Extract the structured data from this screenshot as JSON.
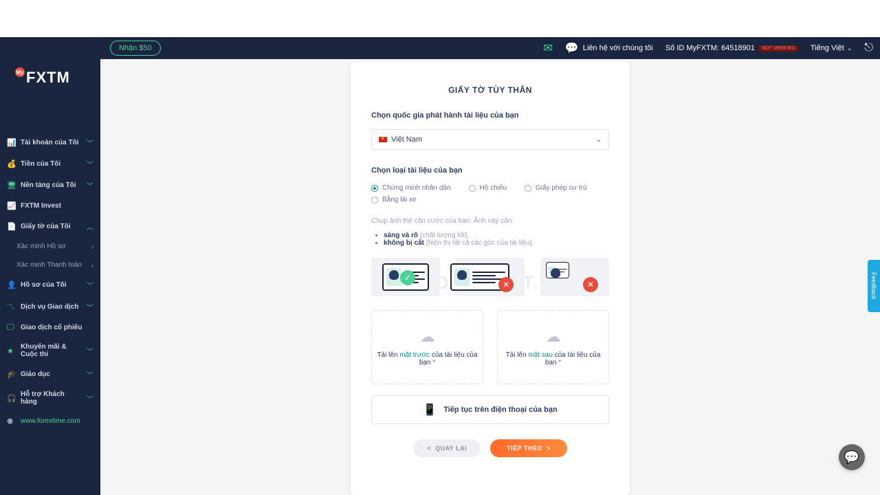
{
  "header": {
    "bonus_label": "Nhận $50",
    "contact_label": "Liên hệ với chúng tôi",
    "account_id_label": "Số ID MyFXTM: 64518901",
    "not_verified_badge": "NOT VERIFIED",
    "language": "Tiếng Việt"
  },
  "logo": {
    "my": "My",
    "brand": "FXTM"
  },
  "sidebar": {
    "items": [
      {
        "icon": "📊",
        "label": "Tài khoản của Tôi",
        "expand": "﹀"
      },
      {
        "icon": "💰",
        "label": "Tiền của Tôi",
        "expand": "﹀"
      },
      {
        "icon": "🖥",
        "label": "Nền tảng của Tôi",
        "expand": "﹀"
      },
      {
        "icon": "📈",
        "label": "FXTM Invest"
      },
      {
        "icon": "📄",
        "label": "Giấy tờ của Tôi",
        "expand": "︿"
      },
      {
        "sub": true,
        "label": "Xác minh Hồ sơ",
        "arrow": "›"
      },
      {
        "sub": true,
        "label": "Xác minh Thanh toán",
        "arrow": "›"
      },
      {
        "icon": "👤",
        "label": "Hồ sơ của Tôi",
        "expand": "﹀"
      },
      {
        "icon": "〽",
        "label": "Dịch vụ Giao dịch",
        "expand": "﹀"
      },
      {
        "icon": "🖵",
        "label": "Giao dịch cổ phiếu"
      },
      {
        "icon": "★",
        "label": "Khuyến mãi & Cuộc thi",
        "expand": "﹀"
      },
      {
        "icon": "🎓",
        "label": "Giáo dục",
        "expand": "﹀"
      },
      {
        "icon": "🎧",
        "label": "Hỗ trợ Khách hàng",
        "expand": "﹀"
      },
      {
        "icon": "⊗",
        "label": "www.forextime.com",
        "link": true
      }
    ]
  },
  "main": {
    "title": "GIẤY TỜ TÙY THÂN",
    "country_label": "Chọn quốc gia phát hành tài liệu của bạn",
    "country_value": "Việt Nam",
    "doc_type_label": "Chọn loại tài liệu của bạn",
    "doc_options": [
      {
        "label": "Chứng minh nhân dân",
        "selected": true
      },
      {
        "label": "Hộ chiếu"
      },
      {
        "label": "Giấy phép cư trú"
      },
      {
        "label": "Bằng lái xe"
      }
    ],
    "photo_hint": "Chụp ảnh thẻ căn cước của bạn. Ảnh này cần:",
    "req1_bold": "sáng và rõ",
    "req1_muted": "(chất lượng tốt),",
    "req2_bold": "không bị cắt",
    "req2_muted": "(hiện thị tất cả các góc của tài liệu).",
    "upload_front_pre": "Tải lên ",
    "upload_front_hl": "mặt trước",
    "upload_front_post": " của tài liệu của bạn ",
    "upload_back_pre": "Tải lên ",
    "upload_back_hl": "mặt sau",
    "upload_back_post": " của tài liệu của bạn ",
    "required": "*",
    "continue_phone": "Tiếp tục trên điện thoại của bạn",
    "back_btn": "QUAY LẠI",
    "next_btn": "TIẾP THEO"
  },
  "misc": {
    "feedback": "Feedback",
    "watermark": "TRADERPTKT.COM"
  }
}
